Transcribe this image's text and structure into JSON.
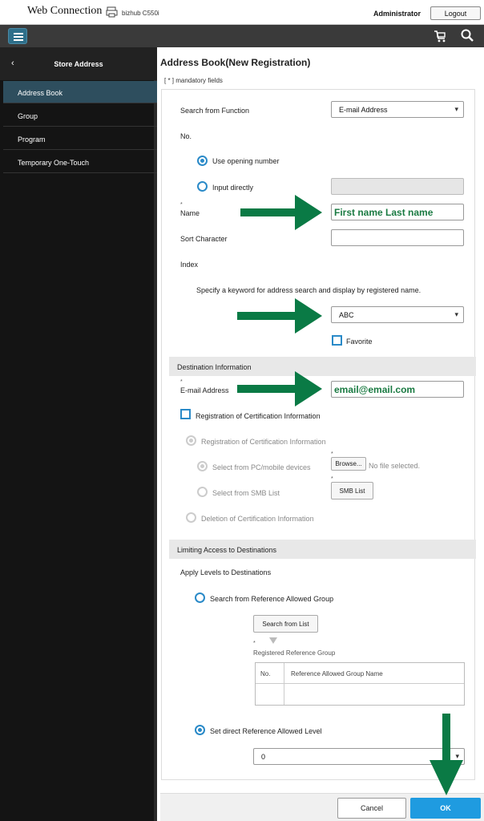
{
  "header": {
    "brand": "Web Connection",
    "model": "bizhub C550i",
    "user": "Administrator",
    "logout_label": "Logout"
  },
  "sidebar": {
    "title": "Store Address",
    "back_symbol": "‹",
    "items": [
      {
        "label": "Address Book",
        "active": true
      },
      {
        "label": "Group"
      },
      {
        "label": "Program"
      },
      {
        "label": "Temporary One-Touch"
      }
    ]
  },
  "main": {
    "title": "Address Book(New Registration)",
    "mandatory_note": "[ * ] mandatory fields",
    "search_from_function_label": "Search from Function",
    "search_from_function_value": "E-mail Address",
    "no_label": "No.",
    "use_opening_number": "Use opening number",
    "input_directly": "Input directly",
    "name_label": "Name",
    "name_value": "First name Last name",
    "sort_character_label": "Sort Character",
    "index_label": "Index",
    "index_hint": "Specify a keyword for address search and display by registered name.",
    "index_value": "ABC",
    "favorite_label": "Favorite",
    "destination_section": "Destination Information",
    "email_label": "E-mail Address",
    "email_value": "email@email.com",
    "cert_checkbox_label": "Registration of Certification Information",
    "cert_radio_label": "Registration of Certification Information",
    "select_pc_label": "Select from PC/mobile devices",
    "browse_label": "Browse...",
    "no_file_label": "No file selected.",
    "select_smb_label": "Select from SMB List",
    "smb_list_label": "SMB List",
    "deletion_label": "Deletion of Certification Information",
    "limiting_section": "Limiting Access to Destinations",
    "apply_levels_label": "Apply Levels to Destinations",
    "search_ref_group_label": "Search from Reference Allowed Group",
    "search_from_list_label": "Search from List",
    "registered_ref_group_label": "Registered Reference Group",
    "table_headers": [
      "No.",
      "Reference Allowed Group Name"
    ],
    "set_direct_level_label": "Set direct Reference Allowed Level",
    "level_value": "0"
  },
  "footer": {
    "cancel_label": "Cancel",
    "ok_label": "OK"
  },
  "colors": {
    "accent": "#1f9be0",
    "annotation_arrow": "#0a7a45",
    "sidebar_active": "#2e4e5e"
  }
}
